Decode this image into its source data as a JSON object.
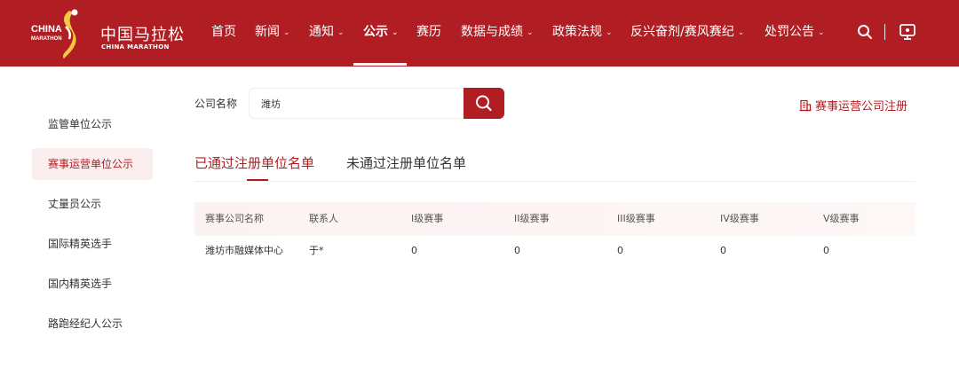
{
  "header": {
    "logo": {
      "mark_text_1": "CHINA",
      "mark_text_2": "MARATHON",
      "name_cn": "中国马拉松",
      "name_en": "CHINA MARATHON"
    },
    "nav": [
      {
        "label": "首页",
        "has_dropdown": false
      },
      {
        "label": "新闻",
        "has_dropdown": true
      },
      {
        "label": "通知",
        "has_dropdown": true
      },
      {
        "label": "公示",
        "has_dropdown": true,
        "active": true
      },
      {
        "label": "赛历",
        "has_dropdown": false
      },
      {
        "label": "数据与成绩",
        "has_dropdown": true
      },
      {
        "label": "政策法规",
        "has_dropdown": true
      },
      {
        "label": "反兴奋剂/赛风赛纪",
        "has_dropdown": true
      },
      {
        "label": "处罚公告",
        "has_dropdown": true
      }
    ],
    "icons": {
      "search": "search-icon",
      "screen": "monitor-icon",
      "chevron": "⌄"
    },
    "accent_color": "#b01e23"
  },
  "sidebar": {
    "items": [
      {
        "label": "监管单位公示"
      },
      {
        "label": "赛事运营单位公示",
        "active": true
      },
      {
        "label": "丈量员公示"
      },
      {
        "label": "国际精英选手"
      },
      {
        "label": "国内精英选手"
      },
      {
        "label": "路跑经纪人公示"
      }
    ]
  },
  "search": {
    "label": "公司名称",
    "value": "潍坊",
    "button_icon": "search-icon"
  },
  "register_link": {
    "label": "赛事运营公司注册",
    "icon": "building-icon"
  },
  "tabs": [
    {
      "label": "已通过注册单位名单",
      "active": true
    },
    {
      "label": "未通过注册单位名单",
      "active": false
    }
  ],
  "table": {
    "headers": [
      "赛事公司名称",
      "联系人",
      "I级赛事",
      "II级赛事",
      "III级赛事",
      "IV级赛事",
      "V级赛事"
    ],
    "rows": [
      [
        "潍坊市融媒体中心",
        "于*",
        "0",
        "0",
        "0",
        "0",
        "0"
      ]
    ]
  }
}
